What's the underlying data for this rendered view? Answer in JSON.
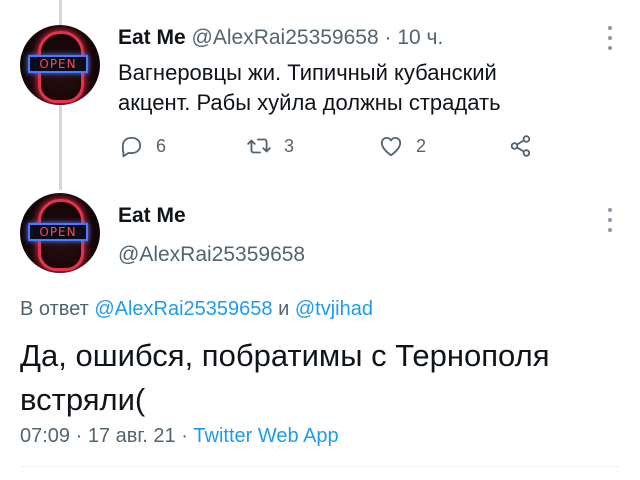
{
  "tweet1": {
    "name": "Eat Me",
    "handle": "@AlexRai25359658",
    "separator": "·",
    "time": "10 ч.",
    "text": "Вагнеровцы жи. Типичный кубанский акцент. Рабы хуйла должны страдать",
    "avatar_sign": "OPEN",
    "actions": {
      "reply_icon": "reply-icon",
      "reply_count": "6",
      "retweet_icon": "retweet-icon",
      "retweet_count": "3",
      "like_icon": "heart-icon",
      "like_count": "2",
      "share_icon": "share-icon"
    }
  },
  "tweet2": {
    "name": "Eat Me",
    "handle": "@AlexRai25359658",
    "avatar_sign": "OPEN",
    "reply_prefix": "В ответ",
    "reply_user1": "@AlexRai25359658",
    "reply_and": "и",
    "reply_user2": "@tvjihad",
    "text": "Да, ошибся, побратимы с Тернополя встряли(",
    "time": "07:09",
    "separator": "·",
    "date": "17 авг. 21",
    "source": "Twitter Web App"
  },
  "colors": {
    "accent": "#1d9bf0",
    "secondary_text": "#536471",
    "primary_text": "#0f1419"
  }
}
